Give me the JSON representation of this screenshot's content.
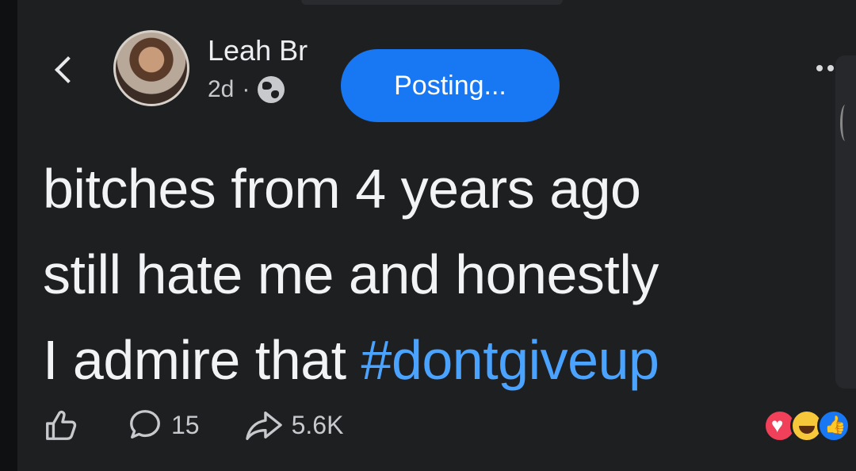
{
  "post": {
    "author_name_visible": "Leah Br",
    "timestamp": "2d",
    "separator": "·",
    "posting_label": "Posting...",
    "text_lines": [
      "bitches from 4 years ago",
      "still hate me and honestly",
      "I admire that "
    ],
    "hashtag": "#dontgiveup"
  },
  "actions": {
    "comment_count": "15",
    "share_count": "5.6K"
  },
  "colors": {
    "background": "#1e1f21",
    "accent": "#1877f2",
    "hashtag": "#4aa3ff"
  },
  "icons": {
    "back": "chevron-left-icon",
    "audience": "globe-icon",
    "like": "thumbs-up-icon",
    "comment": "comment-bubble-icon",
    "share": "share-arrow-icon",
    "more": "more-dots-icon"
  }
}
